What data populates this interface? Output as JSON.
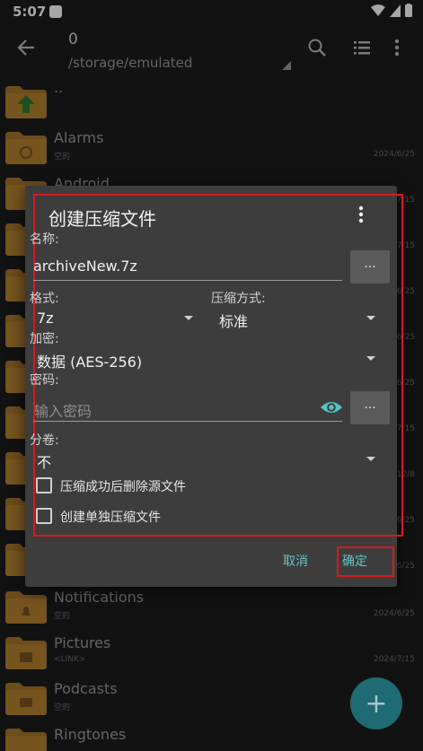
{
  "status_bar": {
    "time": "5:07"
  },
  "app_bar": {
    "title": "0",
    "path": "/storage/emulated"
  },
  "files": [
    {
      "name": "..",
      "meta": "",
      "date": ""
    },
    {
      "name": "Alarms",
      "meta": "空的",
      "date": "2024/6/25"
    },
    {
      "name": "Android",
      "meta": "",
      "date": "7/15"
    },
    {
      "name": "",
      "meta": "",
      "date": "7/15"
    },
    {
      "name": "",
      "meta": "",
      "date": "6/25"
    },
    {
      "name": "",
      "meta": "",
      "date": "6/25"
    },
    {
      "name": "",
      "meta": "",
      "date": "6/25"
    },
    {
      "name": "",
      "meta": "",
      "date": "7/15"
    },
    {
      "name": "",
      "meta": "",
      "date": "12/8"
    },
    {
      "name": "",
      "meta": "",
      "date": "6/25"
    },
    {
      "name": "",
      "meta": "",
      "date": "6/25"
    },
    {
      "name": "Notifications",
      "meta": "空的",
      "date": "2024/6/25"
    },
    {
      "name": "Pictures",
      "meta": "<LINK>",
      "date": "2024/7/15"
    },
    {
      "name": "Podcasts",
      "meta": "空的",
      "date": ""
    },
    {
      "name": "Ringtones",
      "meta": "",
      "date": ""
    }
  ],
  "dialog": {
    "title": "创建压缩文件",
    "name_label": "名称:",
    "name_value": "archiveNew.7z",
    "browse_label": "...",
    "format_label": "格式:",
    "format_value": "7z",
    "compression_label": "压缩方式:",
    "compression_value": "标准",
    "encryption_label": "加密:",
    "encryption_value": "数据 (AES-256)",
    "password_label": "密码:",
    "password_placeholder": "输入密码",
    "password_more_label": "...",
    "split_label": "分卷:",
    "split_value": "不",
    "delete_source_label": "压缩成功后删除源文件",
    "separate_archive_label": "创建单独压缩文件",
    "cancel_label": "取消",
    "ok_label": "确定"
  },
  "fab": {
    "label": "+"
  },
  "colors": {
    "accent": "#66c2c4",
    "folder": "#b07a2a",
    "highlight": "#d9191e",
    "dialog_bg": "#3d3d3d"
  }
}
